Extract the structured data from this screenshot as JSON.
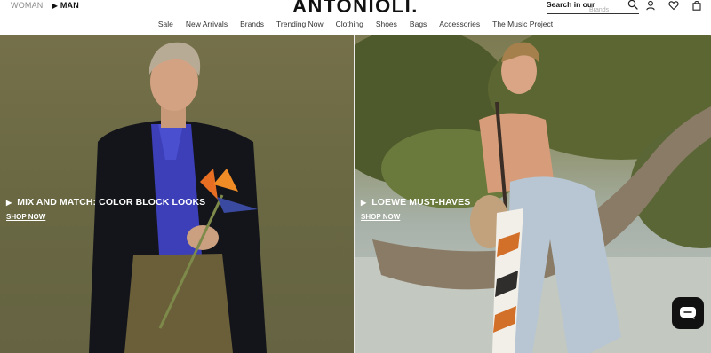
{
  "header": {
    "logo": "ANTONIOLI.",
    "gender": {
      "woman": "WOMAN",
      "man": "MAN"
    },
    "search": {
      "label": "Search in our",
      "placeholder": "Brands"
    },
    "icons": [
      "search-icon",
      "user-icon",
      "wishlist-icon",
      "bag-icon"
    ]
  },
  "nav": {
    "items": [
      "Sale",
      "New Arrivals",
      "Brands",
      "Trending Now",
      "Clothing",
      "Shoes",
      "Bags",
      "Accessories",
      "The Music Project"
    ]
  },
  "heroes": [
    {
      "title": "MIX AND MATCH: COLOR BLOCK LOOKS",
      "cta": "SHOP NOW"
    },
    {
      "title": "LOEWE MUST-HAVES",
      "cta": "SHOP NOW"
    }
  ],
  "chat": {
    "icon": "chat-icon",
    "color": "#111111"
  }
}
